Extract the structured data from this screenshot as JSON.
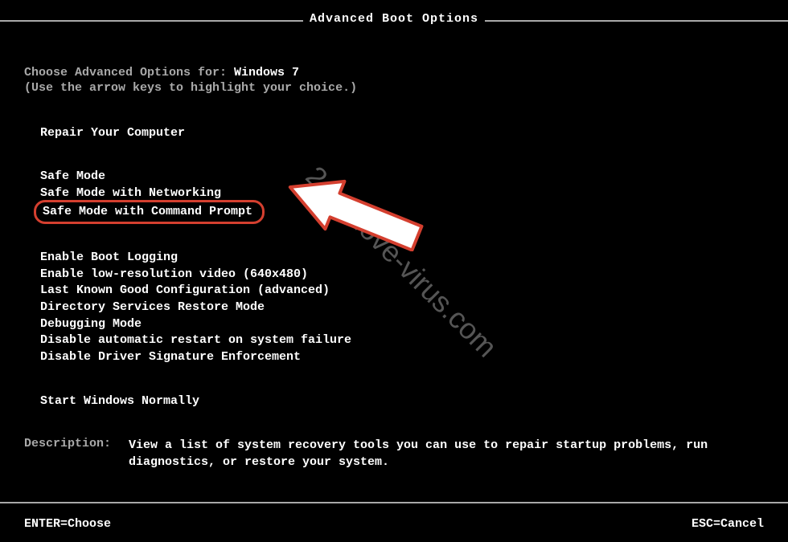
{
  "title": "Advanced Boot Options",
  "prompt": {
    "prefix": "Choose Advanced Options for: ",
    "os": "Windows 7"
  },
  "instruction": "(Use the arrow keys to highlight your choice.)",
  "group1": {
    "item0": "Repair Your Computer"
  },
  "group2": {
    "item0": "Safe Mode",
    "item1": "Safe Mode with Networking",
    "item2": "Safe Mode with Command Prompt"
  },
  "group3": {
    "item0": "Enable Boot Logging",
    "item1": "Enable low-resolution video (640x480)",
    "item2": "Last Known Good Configuration (advanced)",
    "item3": "Directory Services Restore Mode",
    "item4": "Debugging Mode",
    "item5": "Disable automatic restart on system failure",
    "item6": "Disable Driver Signature Enforcement"
  },
  "group4": {
    "item0": "Start Windows Normally"
  },
  "description": {
    "label": "Description:",
    "text": "View a list of system recovery tools you can use to repair startup problems, run diagnostics, or restore your system."
  },
  "footer": {
    "enter": "ENTER=Choose",
    "esc": "ESC=Cancel"
  },
  "watermark": "2-remove-virus.com"
}
